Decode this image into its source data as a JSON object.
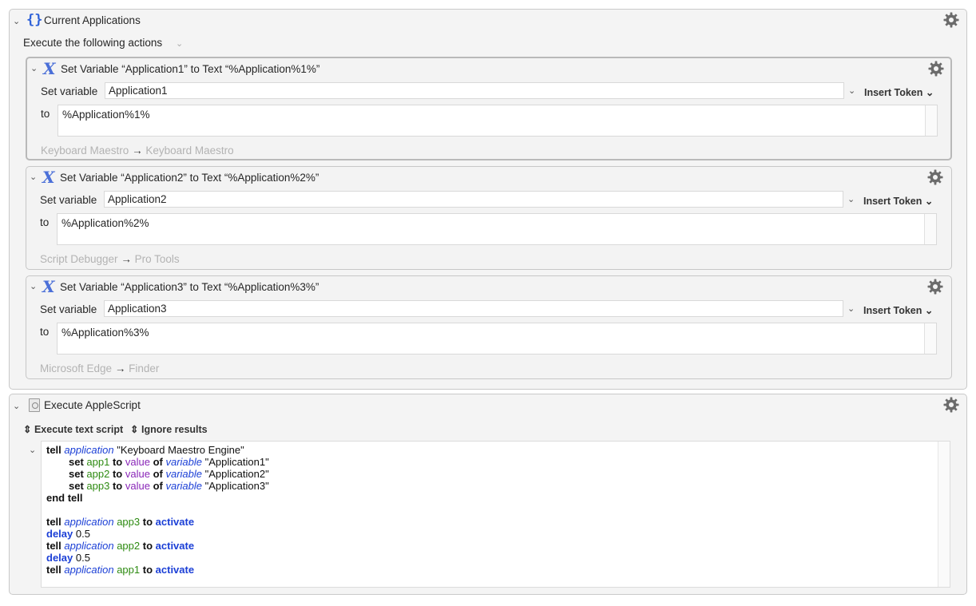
{
  "group": {
    "title": "Current Applications",
    "execute_label": "Execute the following actions"
  },
  "actions": [
    {
      "title": "Set Variable “Application1” to Text “%Application%1%”",
      "set_variable_label": "Set variable",
      "variable_name": "Application1",
      "to_label": "to",
      "text_value": "%Application%1%",
      "insert_token_label": "Insert Token",
      "footer_from": "Keyboard Maestro",
      "footer_to": "Keyboard Maestro"
    },
    {
      "title": "Set Variable “Application2” to Text “%Application%2%”",
      "set_variable_label": "Set variable",
      "variable_name": "Application2",
      "to_label": "to",
      "text_value": "%Application%2%",
      "insert_token_label": "Insert Token",
      "footer_from": "Script Debugger",
      "footer_to": "Pro Tools"
    },
    {
      "title": "Set Variable “Application3” to Text “%Application%3%”",
      "set_variable_label": "Set variable",
      "variable_name": "Application3",
      "to_label": "to",
      "text_value": "%Application%3%",
      "insert_token_label": "Insert Token",
      "footer_from": "Microsoft Edge",
      "footer_to": "Finder"
    }
  ],
  "applescript": {
    "title": "Execute AppleScript",
    "execute_option": "Execute text script",
    "results_option": "Ignore results",
    "code": {
      "l1": [
        "tell",
        "application",
        "\"Keyboard Maestro Engine\""
      ],
      "l2": [
        "set",
        "app1",
        "to",
        "value",
        "of",
        "variable",
        "\"Application1\""
      ],
      "l3": [
        "set",
        "app2",
        "to",
        "value",
        "of",
        "variable",
        "\"Application2\""
      ],
      "l4": [
        "set",
        "app3",
        "to",
        "value",
        "of",
        "variable",
        "\"Application3\""
      ],
      "l5": "end tell",
      "l7": [
        "tell",
        "application",
        "app3",
        "to",
        "activate"
      ],
      "l8": [
        "delay",
        "0.5"
      ],
      "l9": [
        "tell",
        "application",
        "app2",
        "to",
        "activate"
      ],
      "l10": [
        "delay",
        "0.5"
      ],
      "l11": [
        "tell",
        "application",
        "app1",
        "to",
        "activate"
      ]
    }
  },
  "icons": {
    "group_icon": "braces-icon",
    "action_icon": "variable-x-icon",
    "script_icon": "applescript-doc-icon",
    "settings_icon": "gear-icon"
  },
  "colors": {
    "keyword_blue": "#1b3fd6",
    "variable_green": "#2e8b12",
    "property_purple": "#8a27b8"
  }
}
